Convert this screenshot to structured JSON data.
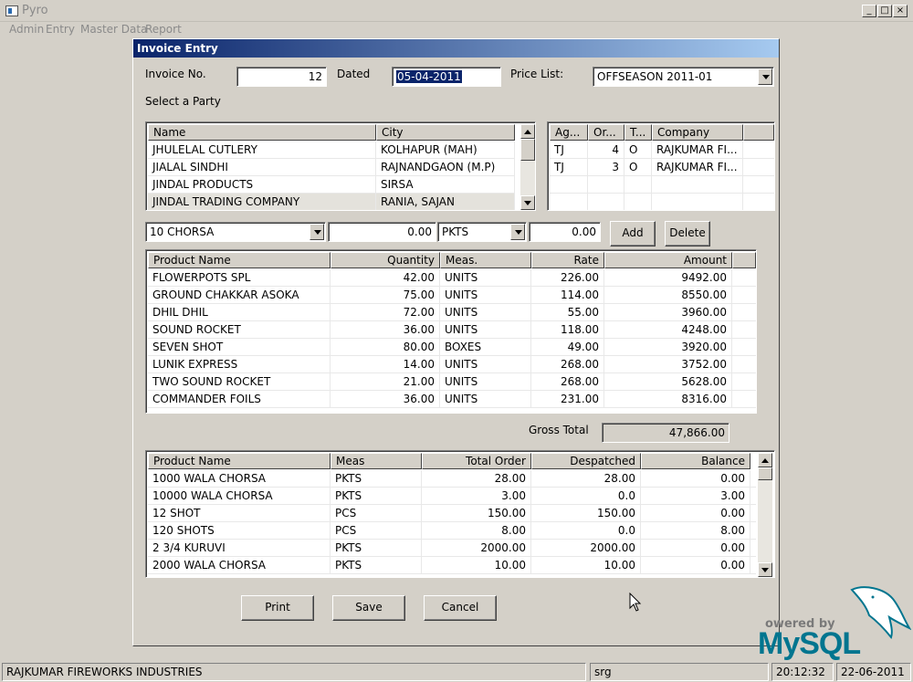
{
  "app": {
    "title": "Pyro",
    "menu": [
      "Admin",
      "Entry",
      "Master Data",
      "Report"
    ]
  },
  "dialog": {
    "title": "Invoice Entry",
    "invoice_no_label": "Invoice No.",
    "invoice_no": "12",
    "dated_label": "Dated",
    "dated": "05-04-2011",
    "price_list_label": "Price List:",
    "price_list": "OFFSEASON 2011-01",
    "select_party_label": "Select a Party"
  },
  "party_table": {
    "headers": [
      "Name",
      "City"
    ],
    "rows": [
      [
        "JHULELAL CUTLERY",
        "KOLHAPUR (MAH)"
      ],
      [
        "JIALAL SINDHI",
        "RAJNANDGAON (M.P)"
      ],
      [
        "JINDAL PRODUCTS",
        "SIRSA"
      ],
      [
        "JINDAL TRADING COMPANY",
        "RANIA, SAJAN"
      ]
    ]
  },
  "agent_table": {
    "headers": [
      "Ag...",
      "Or...",
      "T...",
      "Company"
    ],
    "rows": [
      [
        "TJ",
        "4",
        "O",
        "RAJKUMAR FI..."
      ],
      [
        "TJ",
        "3",
        "O",
        "RAJKUMAR FI..."
      ]
    ]
  },
  "entry_row": {
    "product": "10 CHORSA",
    "quantity": "0.00",
    "meas": "PKTS",
    "rate": "0.00",
    "add_label": "Add",
    "delete_label": "Delete"
  },
  "product_table": {
    "headers": [
      "Product Name",
      "Quantity",
      "Meas.",
      "Rate",
      "Amount"
    ],
    "rows": [
      [
        "FLOWERPOTS SPL",
        "42.00",
        "UNITS",
        "226.00",
        "9492.00"
      ],
      [
        "GROUND CHAKKAR ASOKA",
        "75.00",
        "UNITS",
        "114.00",
        "8550.00"
      ],
      [
        "DHIL DHIL",
        "72.00",
        "UNITS",
        "55.00",
        "3960.00"
      ],
      [
        "SOUND ROCKET",
        "36.00",
        "UNITS",
        "118.00",
        "4248.00"
      ],
      [
        "SEVEN SHOT",
        "80.00",
        "BOXES",
        "49.00",
        "3920.00"
      ],
      [
        "LUNIK EXPRESS",
        "14.00",
        "UNITS",
        "268.00",
        "3752.00"
      ],
      [
        "TWO SOUND ROCKET",
        "21.00",
        "UNITS",
        "268.00",
        "5628.00"
      ],
      [
        "COMMANDER FOILS",
        "36.00",
        "UNITS",
        "231.00",
        "8316.00"
      ]
    ]
  },
  "gross_total": {
    "label": "Gross Total",
    "value": "47,866.00"
  },
  "order_table": {
    "headers": [
      "Product Name",
      "Meas",
      "Total Order",
      "Despatched",
      "Balance"
    ],
    "rows": [
      [
        "1000 WALA CHORSA",
        "PKTS",
        "28.00",
        "28.00",
        "0.00"
      ],
      [
        "10000 WALA CHORSA",
        "PKTS",
        "3.00",
        "0.0",
        "3.00"
      ],
      [
        "12 SHOT",
        "PCS",
        "150.00",
        "150.00",
        "0.00"
      ],
      [
        "120 SHOTS",
        "PCS",
        "8.00",
        "0.0",
        "8.00"
      ],
      [
        "2 3/4 KURUVI",
        "PKTS",
        "2000.00",
        "2000.00",
        "0.00"
      ],
      [
        "2000 WALA CHORSA",
        "PKTS",
        "10.00",
        "10.00",
        "0.00"
      ]
    ]
  },
  "buttons": {
    "print": "Print",
    "save": "Save",
    "cancel": "Cancel"
  },
  "status_bar": {
    "company": "RAJKUMAR FIREWORKS INDUSTRIES",
    "user": "srg",
    "time": "20:12:32",
    "date": "22-06-2011"
  },
  "logo": {
    "powered_by": "owered by",
    "brand": "MySQL",
    "color": "#00758f"
  }
}
